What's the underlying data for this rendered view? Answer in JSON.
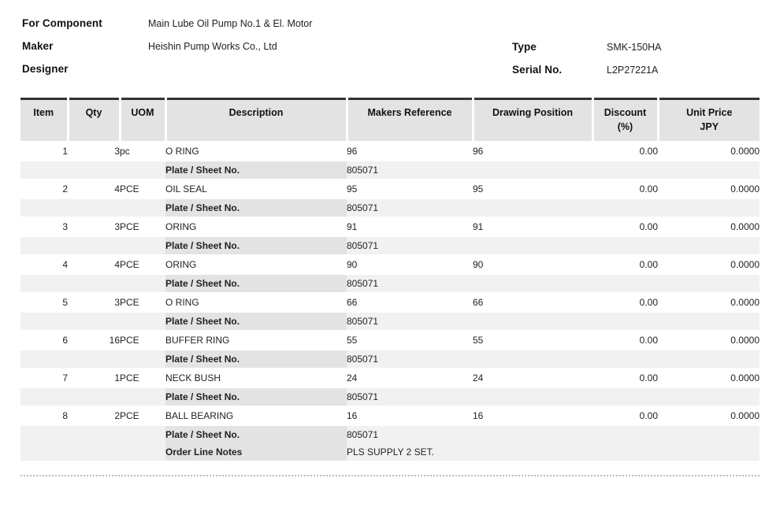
{
  "header": {
    "left_fields": [
      {
        "label": "For Component",
        "value": "Main Lube Oil Pump No.1 & El. Motor"
      },
      {
        "label": "Maker",
        "value": "Heishin Pump Works Co., Ltd"
      },
      {
        "label": "Designer",
        "value": ""
      }
    ],
    "right_fields": [
      {
        "label": "Type",
        "value": "SMK-150HA"
      },
      {
        "label": "Serial No.",
        "value": "L2P27221A"
      }
    ]
  },
  "table": {
    "columns": [
      {
        "key": "item",
        "label": "Item"
      },
      {
        "key": "qty",
        "label": "Qty"
      },
      {
        "key": "uom",
        "label": "UOM"
      },
      {
        "key": "description",
        "label": "Description"
      },
      {
        "key": "makers_reference",
        "label": "Makers Reference"
      },
      {
        "key": "drawing_position",
        "label": "Drawing Position"
      },
      {
        "key": "discount",
        "label": "Discount\n(%)",
        "label_line1": "Discount",
        "label_line2": "(%)"
      },
      {
        "key": "unit_price",
        "label": "Unit Price\nJPY",
        "label_line1": "Unit Price",
        "label_line2": "JPY"
      }
    ],
    "rows": [
      {
        "item": "1",
        "qty": "3",
        "uom": "pc",
        "description": "O RING",
        "makers_reference": "96",
        "drawing_position": "96",
        "discount": "0.00",
        "unit_price": "0.0000",
        "sub_rows": [
          {
            "label": "Plate / Sheet No.",
            "value": "805071"
          }
        ]
      },
      {
        "item": "2",
        "qty": "4",
        "uom": "PCE",
        "description": "OIL SEAL",
        "makers_reference": "95",
        "drawing_position": "95",
        "discount": "0.00",
        "unit_price": "0.0000",
        "sub_rows": [
          {
            "label": "Plate / Sheet No.",
            "value": "805071"
          }
        ]
      },
      {
        "item": "3",
        "qty": "3",
        "uom": "PCE",
        "description": "ORING",
        "makers_reference": "91",
        "drawing_position": "91",
        "discount": "0.00",
        "unit_price": "0.0000",
        "sub_rows": [
          {
            "label": "Plate / Sheet No.",
            "value": "805071"
          }
        ]
      },
      {
        "item": "4",
        "qty": "4",
        "uom": "PCE",
        "description": "ORING",
        "makers_reference": "90",
        "drawing_position": "90",
        "discount": "0.00",
        "unit_price": "0.0000",
        "sub_rows": [
          {
            "label": "Plate / Sheet No.",
            "value": "805071"
          }
        ]
      },
      {
        "item": "5",
        "qty": "3",
        "uom": "PCE",
        "description": "O RING",
        "makers_reference": "66",
        "drawing_position": "66",
        "discount": "0.00",
        "unit_price": "0.0000",
        "sub_rows": [
          {
            "label": "Plate / Sheet No.",
            "value": "805071"
          }
        ]
      },
      {
        "item": "6",
        "qty": "16",
        "uom": "PCE",
        "description": "BUFFER RING",
        "makers_reference": "55",
        "drawing_position": "55",
        "discount": "0.00",
        "unit_price": "0.0000",
        "sub_rows": [
          {
            "label": "Plate / Sheet No.",
            "value": "805071"
          }
        ]
      },
      {
        "item": "7",
        "qty": "1",
        "uom": "PCE",
        "description": "NECK BUSH",
        "makers_reference": "24",
        "drawing_position": "24",
        "discount": "0.00",
        "unit_price": "0.0000",
        "sub_rows": [
          {
            "label": "Plate / Sheet No.",
            "value": "805071"
          }
        ]
      },
      {
        "item": "8",
        "qty": "2",
        "uom": "PCE",
        "description": "BALL BEARING",
        "makers_reference": "16",
        "drawing_position": "16",
        "discount": "0.00",
        "unit_price": "0.0000",
        "sub_rows": [
          {
            "label": "Plate / Sheet No.",
            "value": "805071"
          },
          {
            "label": "Order Line Notes",
            "value": "PLS SUPPLY 2 SET."
          }
        ]
      }
    ]
  },
  "colors": {
    "header_background": "#e3e3e3",
    "header_rule": "#333333",
    "sub_row_background": "#f1f1f1",
    "sub_label_background": "#e3e3e3",
    "footer_rule": "#b9b9b9"
  }
}
